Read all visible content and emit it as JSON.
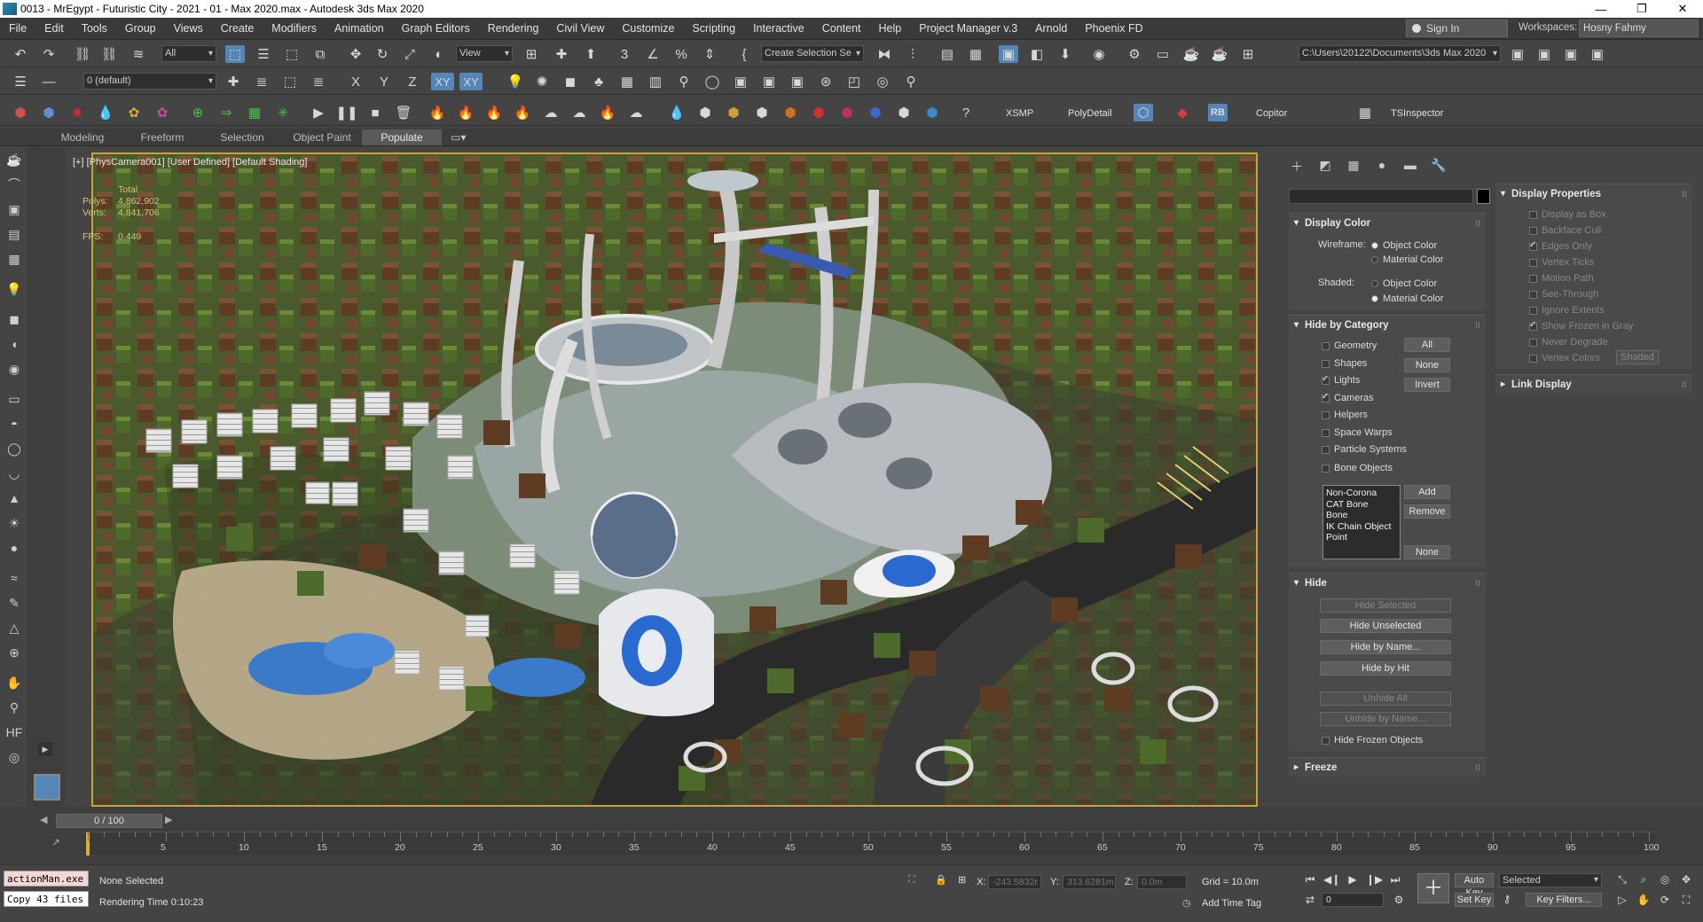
{
  "title": "0013 - MrEgypt - Futuristic City - 2021 - 01 - Max 2020.max - Autodesk 3ds Max 2020",
  "menu": [
    "File",
    "Edit",
    "Tools",
    "Group",
    "Views",
    "Create",
    "Modifiers",
    "Animation",
    "Graph Editors",
    "Rendering",
    "Civil View",
    "Customize",
    "Scripting",
    "Interactive",
    "Content",
    "Help",
    "Project Manager v.3",
    "Arnold",
    "Phoenix FD"
  ],
  "account": {
    "sign_in": "Sign In",
    "workspaces_label": "Workspaces:",
    "workspace": "Hosny Fahmy"
  },
  "toolbar1": {
    "filter": "All",
    "view": "View",
    "selection_set": "Create Selection Se",
    "path": "C:\\Users\\20122\\Documents\\3ds Max 2020"
  },
  "toolbar2": {
    "layer": "0 (default)",
    "axes": [
      "X",
      "Y",
      "Z",
      "XY",
      "XY"
    ]
  },
  "toolbar3": {
    "labels": [
      "XSMP",
      "PolyDetail",
      "RB",
      "Copitor",
      "TSInspector"
    ]
  },
  "ribbon": {
    "tabs": [
      "Modeling",
      "Freeform",
      "Selection",
      "Object Paint",
      "Populate"
    ],
    "active": "Populate"
  },
  "viewport": {
    "label": "[+] [PhysCamera001] [User Defined] [Default Shading]",
    "stats_header": "Total",
    "polys_label": "Polys:",
    "polys": "4,862,902",
    "verts_label": "Verts:",
    "verts": "4,841,706",
    "fps_label": "FPS:",
    "fps": "0.449"
  },
  "display_panel": {
    "display_color": {
      "title": "Display Color",
      "wireframe_label": "Wireframe:",
      "shaded_label": "Shaded:",
      "object_color": "Object Color",
      "material_color": "Material Color"
    },
    "hide_by_category": {
      "title": "Hide by Category",
      "items": [
        {
          "label": "Geometry",
          "checked": false
        },
        {
          "label": "Shapes",
          "checked": false
        },
        {
          "label": "Lights",
          "checked": true
        },
        {
          "label": "Cameras",
          "checked": true
        },
        {
          "label": "Helpers",
          "checked": false
        },
        {
          "label": "Space Warps",
          "checked": false
        },
        {
          "label": "Particle Systems",
          "checked": false
        },
        {
          "label": "Bone Objects",
          "checked": false
        }
      ],
      "buttons": [
        "All",
        "None",
        "Invert"
      ],
      "list": [
        "Non-Corona",
        "CAT Bone",
        "Bone",
        "IK Chain Object",
        "Point"
      ],
      "add": "Add",
      "remove": "Remove",
      "none": "None"
    },
    "hide": {
      "title": "Hide",
      "buttons": [
        "Hide Selected",
        "Hide Unselected",
        "Hide by Name...",
        "Hide by Hit",
        "Unhide All",
        "Unhide by Name..."
      ],
      "frozen": "Hide Frozen Objects"
    },
    "freeze": {
      "title": "Freeze"
    },
    "display_properties": {
      "title": "Display Properties",
      "items": [
        {
          "label": "Display as Box",
          "checked": false
        },
        {
          "label": "Backface Cull",
          "checked": false
        },
        {
          "label": "Edges Only",
          "checked": true
        },
        {
          "label": "Vertex Ticks",
          "checked": false
        },
        {
          "label": "Motion Path",
          "checked": false
        },
        {
          "label": "See-Through",
          "checked": false
        },
        {
          "label": "Ignore Extents",
          "checked": false
        },
        {
          "label": "Show Frozen in Gray",
          "checked": true
        },
        {
          "label": "Never Degrade",
          "checked": false
        },
        {
          "label": "Vertex Colors",
          "checked": false
        }
      ],
      "shaded_btn": "Shaded"
    },
    "link_display": {
      "title": "Link Display"
    }
  },
  "timeline": {
    "slider": "0 / 100",
    "ticks": [
      0,
      5,
      10,
      15,
      20,
      25,
      30,
      35,
      40,
      45,
      50,
      55,
      60,
      65,
      70,
      75,
      80,
      85,
      90,
      95,
      100
    ]
  },
  "status": {
    "script_line1": "actionMan.exe",
    "script_line2": "Copy 43 files",
    "selection": "None Selected",
    "render_time": "Rendering Time  0:10:23",
    "x_label": "X:",
    "x": "-243.5832r",
    "y_label": "Y:",
    "y": "313.6281m",
    "z_label": "Z:",
    "z": "0.0m",
    "grid": "Grid = 10.0m",
    "add_time_tag": "Add Time Tag",
    "auto_key": "Auto Key",
    "selected": "Selected",
    "set_key": "Set Key",
    "key_filters": "Key Filters...",
    "frame": "0"
  },
  "colors": {
    "accent": "#5685b8",
    "viewport_border": "#c8a23c"
  }
}
